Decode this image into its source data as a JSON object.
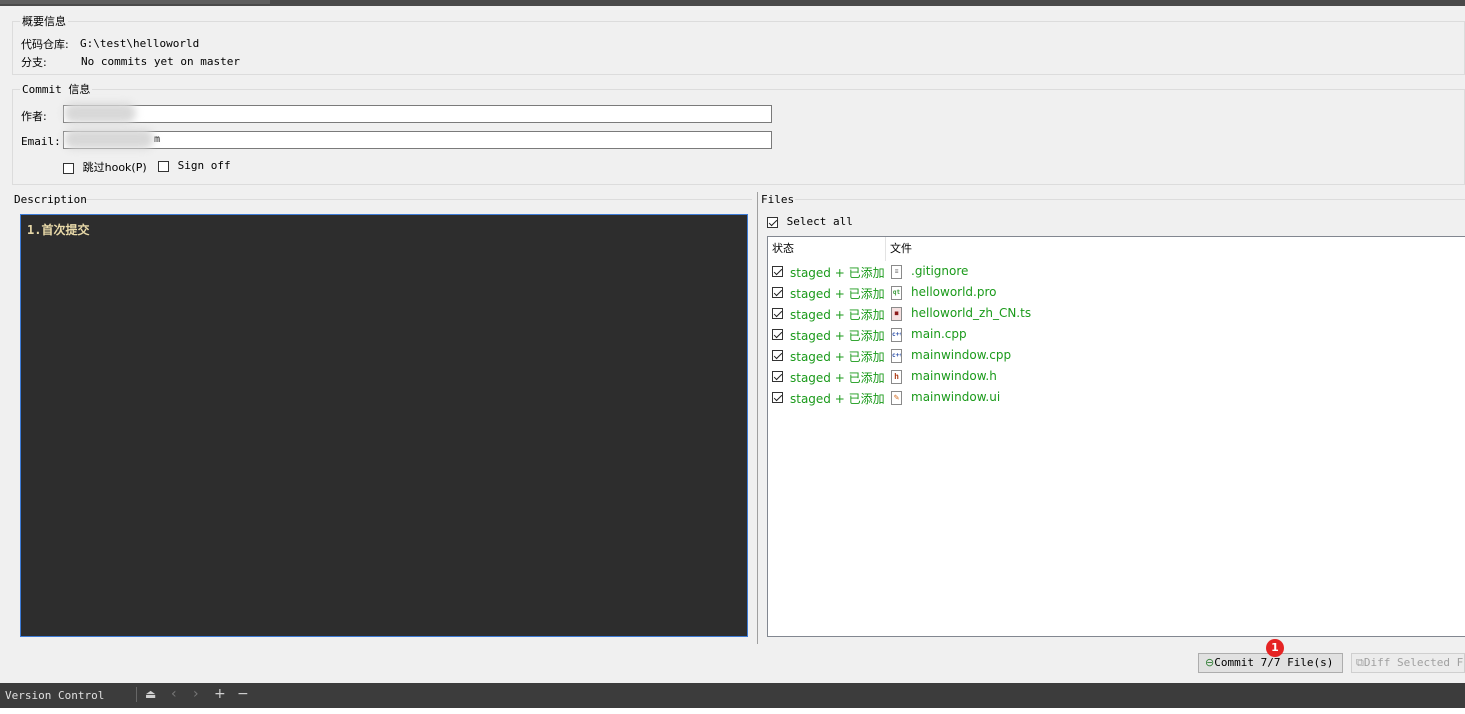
{
  "summary": {
    "legend": "概要信息",
    "repo_label": "代码仓库:",
    "repo_value": "G:\\test\\helloworld",
    "branch_label": "分支:",
    "branch_value": "No commits yet on master"
  },
  "commit_info": {
    "legend_prefix": "Commit",
    "legend_suffix": "信息",
    "author_label": "作者:",
    "author_value": "",
    "email_label": "Email:",
    "email_value": "m",
    "skip_hook_label": "跳过hook(P)",
    "sign_off_label": "Sign off",
    "skip_hook_checked": false,
    "sign_off_checked": false
  },
  "description": {
    "label": "Description",
    "text": "1.首次提交"
  },
  "files": {
    "label": "Files",
    "select_all_label": "Select all",
    "select_all_checked": true,
    "columns": [
      "状态",
      "文件"
    ],
    "rows": [
      {
        "status": "staged + 已添加",
        "file": ".gitignore",
        "icon": "text-file-icon",
        "checked": true
      },
      {
        "status": "staged + 已添加",
        "file": "helloworld.pro",
        "icon": "qt-project-icon",
        "checked": true
      },
      {
        "status": "staged + 已添加",
        "file": "helloworld_zh_CN.ts",
        "icon": "translation-file-icon",
        "checked": true
      },
      {
        "status": "staged + 已添加",
        "file": "main.cpp",
        "icon": "cpp-file-icon",
        "checked": true
      },
      {
        "status": "staged + 已添加",
        "file": "mainwindow.cpp",
        "icon": "cpp-file-icon",
        "checked": true
      },
      {
        "status": "staged + 已添加",
        "file": "mainwindow.h",
        "icon": "header-file-icon",
        "checked": true
      },
      {
        "status": "staged + 已添加",
        "file": "mainwindow.ui",
        "icon": "ui-form-icon",
        "checked": true
      }
    ]
  },
  "actions": {
    "commit_label": "Commit 7/7 File(s)",
    "diff_label": "Diff Selected Fi",
    "badge": "1"
  },
  "bottom": {
    "panel_title": "Version Control"
  },
  "colors": {
    "status_green": "#1a9a1a",
    "editor_bg": "#2d2d2d",
    "badge_red": "#e52424"
  }
}
